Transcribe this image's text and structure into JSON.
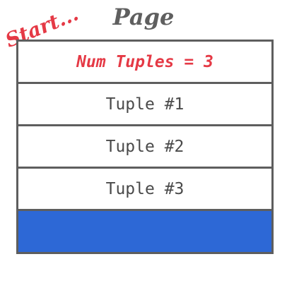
{
  "annotation": {
    "text": "Start..."
  },
  "page": {
    "title": "Page",
    "header": "Num Tuples = 3",
    "tuples": [
      "Tuple #1",
      "Tuple #2",
      "Tuple #3"
    ],
    "free_space_color": "#2d68d6"
  }
}
